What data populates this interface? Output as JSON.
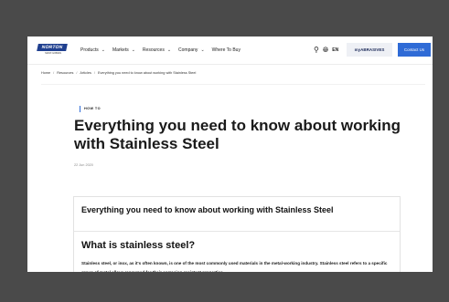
{
  "header": {
    "logo_text": "NORTON",
    "logo_subtext": "SAINT-GOBAIN",
    "nav": [
      {
        "label": "Products",
        "dropdown": true
      },
      {
        "label": "Markets",
        "dropdown": true
      },
      {
        "label": "Resources",
        "dropdown": true
      },
      {
        "label": "Company",
        "dropdown": true
      },
      {
        "label": "Where To Buy",
        "dropdown": false
      }
    ],
    "language": "EN",
    "my_abrasives_label": "myABRASIVES",
    "contact_label": "Contact Us"
  },
  "breadcrumb": [
    "Home",
    "Resources",
    "Articles",
    "Everything you need to know about working with Stainless Steel"
  ],
  "article": {
    "tag": "HOW TO",
    "title": "Everything you need to know about working with Stainless Steel",
    "date": "22 Jun 2020",
    "toc_title": "Everything you need to know about working with Stainless Steel",
    "section_heading": "What is stainless steel?",
    "paragraph": "Stainless steel, or inox, as it's often known, is one of the most commonly used materials in the metal-working industry. Stainless steel refers to a specific group of metal alloys renowned for their corrosion-resistant properties."
  },
  "colors": {
    "brand": "#1f3f8f",
    "accent": "#2f6bd6"
  }
}
